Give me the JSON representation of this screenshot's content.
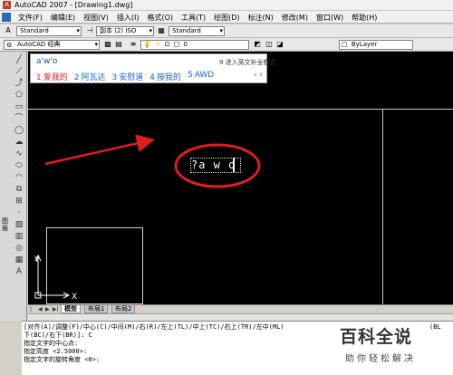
{
  "window": {
    "title": "AutoCAD 2007 - [Drawing1.dwg]"
  },
  "menu": [
    "文件(F)",
    "编辑(E)",
    "视图(V)",
    "插入(I)",
    "格式(O)",
    "工具(T)",
    "绘图(D)",
    "标注(N)",
    "修改(M)",
    "窗口(W)",
    "帮助(H)"
  ],
  "toolbar1": {
    "text_style": "Standard",
    "dim_style": "副本 (2) ISO",
    "table_style": "Standard"
  },
  "toolbar2": {
    "workspace": "AutoCAD 经典",
    "layer": "0",
    "color": "ByLayer"
  },
  "ime": {
    "typed": "a'w'o",
    "hint": "9 进入英文补全模式",
    "candidates": [
      {
        "num": "1",
        "text": "爱我的"
      },
      {
        "num": "2",
        "text": "阿瓦达"
      },
      {
        "num": "3",
        "text": "安慰道"
      },
      {
        "num": "4",
        "text": "按我的"
      },
      {
        "num": "5",
        "text": "AWD"
      }
    ],
    "nav": "‹ ›"
  },
  "canvas": {
    "dtext": "?a w o",
    "ucs_x": "X",
    "ucs_y": "Y"
  },
  "tabs": [
    "模型",
    "布局1",
    "布局2"
  ],
  "side_label": "图层",
  "command_lines": [
    "[对齐(A)/调整(F)/中心(C)/中间(M)/右(R)/左上(TL)/中上(TC)/右上(TR)/左中(ML)",
    "下(BC)/右下(BR)]: C",
    "指定文字的中心点:",
    "指定高度 <2.5000>:",
    "指定文字的旋转角度 <0>:"
  ],
  "command_extra": "(BL",
  "watermark": {
    "title": "百科全说",
    "subtitle": "助你轻松解决"
  },
  "colors": {
    "annotation_red": "#e01e1e",
    "canvas_bg": "#000000"
  }
}
